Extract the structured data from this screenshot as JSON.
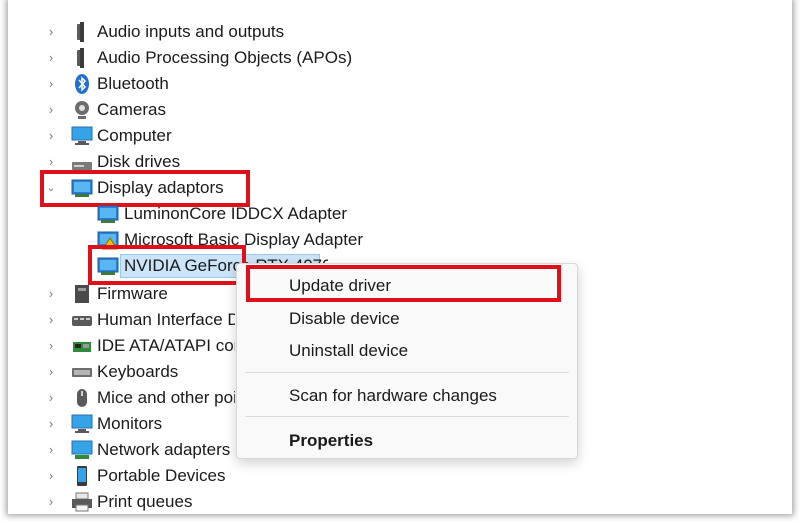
{
  "tree": {
    "items": [
      {
        "label": "Audio inputs and outputs",
        "icon": "speaker-icon",
        "expanded": false
      },
      {
        "label": "Audio Processing Objects (APOs)",
        "icon": "speaker-icon",
        "expanded": false
      },
      {
        "label": "Bluetooth",
        "icon": "bluetooth-icon",
        "expanded": false
      },
      {
        "label": "Cameras",
        "icon": "camera-icon",
        "expanded": false
      },
      {
        "label": "Computer",
        "icon": "computer-icon",
        "expanded": false
      },
      {
        "label": "Disk drives",
        "icon": "disk-drive-icon",
        "expanded": false
      },
      {
        "label": "Display adaptors",
        "icon": "display-adapter-icon",
        "expanded": true
      },
      {
        "label": "LuminonCore IDDCX Adapter",
        "icon": "display-adapter-icon",
        "child": true
      },
      {
        "label": "Microsoft Basic Display Adapter",
        "icon": "display-adapter-warning-icon",
        "child": true
      },
      {
        "label": "NVIDIA GeForce RTX 4070",
        "icon": "display-adapter-icon",
        "child": true,
        "selected": true
      },
      {
        "label": "Firmware",
        "icon": "firmware-icon",
        "expanded": false
      },
      {
        "label": "Human Interface Devices",
        "icon": "hid-icon",
        "expanded": false
      },
      {
        "label": "IDE ATA/ATAPI controllers",
        "icon": "ide-controller-icon",
        "expanded": false
      },
      {
        "label": "Keyboards",
        "icon": "keyboard-icon",
        "expanded": false
      },
      {
        "label": "Mice and other pointing devices",
        "icon": "mouse-icon",
        "expanded": false
      },
      {
        "label": "Monitors",
        "icon": "monitor-icon",
        "expanded": false
      },
      {
        "label": "Network adapters",
        "icon": "network-adapter-icon",
        "expanded": false
      },
      {
        "label": "Portable Devices",
        "icon": "portable-device-icon",
        "expanded": false
      },
      {
        "label": "Print queues",
        "icon": "printer-icon",
        "expanded": false
      }
    ]
  },
  "context_menu": {
    "items": [
      {
        "label": "Update driver",
        "bold": false
      },
      {
        "label": "Disable device",
        "bold": false
      },
      {
        "label": "Uninstall device",
        "bold": false
      },
      {
        "label": "Scan for hardware changes",
        "bold": false
      },
      {
        "label": "Properties",
        "bold": true
      }
    ]
  },
  "colors": {
    "highlight_box": "#e0101a",
    "selection": "#cce4f7",
    "accent": "#2b7fd4"
  }
}
